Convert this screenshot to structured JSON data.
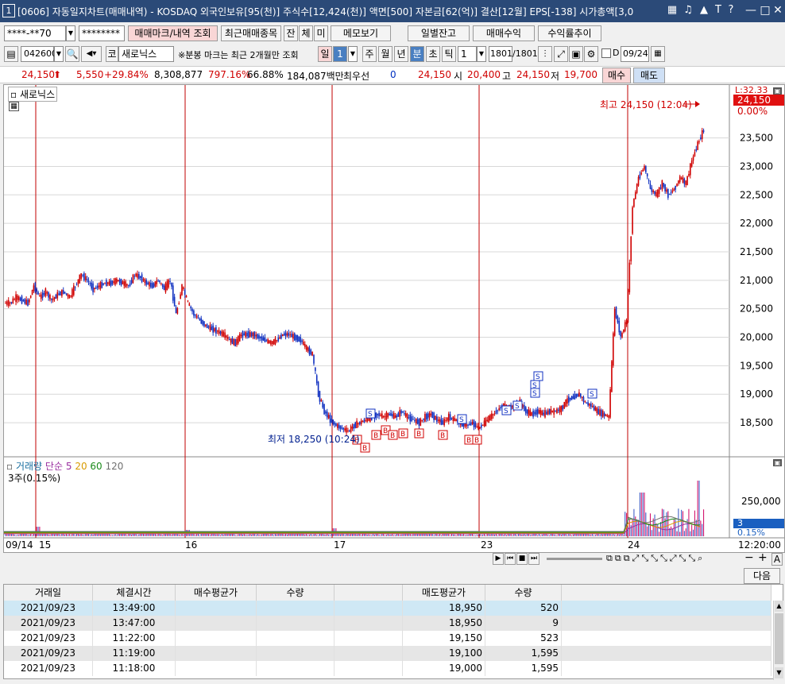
{
  "window": {
    "number": "1",
    "title": "[0606] 자동일지차트(매매내역) - KOSDAQ 외국인보유[95(천)] 주식수[12,424(천)] 액면[500] 자본금[62(억)] 결산[12월] EPS[-138] 시가총액[3,0",
    "icons": [
      "grid-icon",
      "bell-icon",
      "font-icon",
      "help-icon"
    ],
    "controls": [
      "minimize",
      "restore",
      "close"
    ]
  },
  "toolbar1": {
    "account": "****-**70",
    "password": "********",
    "btn_trade_mark": "매매마크/내역 조회",
    "btn_recent": "최근매매종목",
    "btn_jan": "잔",
    "btn_che": "체",
    "btn_mi": "미",
    "btn_memo": "메모보기",
    "btn_daily": "일별잔고",
    "btn_profit": "매매수익",
    "btn_return": "수익률추이"
  },
  "toolbar2": {
    "code": "042600",
    "market": "코",
    "name": "새로닉스",
    "notice": "※분봉 마크는 최근 2개월만 조회",
    "period_day": "일",
    "period_value": "1",
    "period_week": "주",
    "period_month": "월",
    "period_year": "년",
    "period_minute": "분",
    "period_second": "초",
    "period_tick": "틱",
    "interval": "1",
    "count": "1801",
    "total": "/1801",
    "d_label": "D",
    "date": "09/24"
  },
  "quote": {
    "price": "24,150",
    "change": "5,550",
    "change_pct": "+29.84%",
    "volume": "8,308,877",
    "volume_pct": "797.16%",
    "ratio": "66.88%",
    "amount": "184,087백만",
    "best_label": "최우선",
    "best_value": "0",
    "ask": "24,150",
    "open_label": "시",
    "open": "20,400",
    "high_label": "고",
    "high": "24,150",
    "low_label": "저",
    "low": "19,700",
    "buy": "매수",
    "sell": "매도"
  },
  "chart_data": {
    "type": "candlestick",
    "title": "새로닉스",
    "annotations": {
      "high": "최고 24,150 (12:04)",
      "low": "최저 18,250 (10:24)",
      "current_price": "24,150",
      "current_pct": "0.00%",
      "corner": "L:32.33"
    },
    "y_ticks": [
      "23,500",
      "23,000",
      "22,500",
      "22,000",
      "21,500",
      "21,000",
      "20,500",
      "20,000",
      "19,500",
      "19,000",
      "18,500"
    ],
    "x_ticks": [
      "09/14",
      "15",
      "16",
      "17",
      "23",
      "24",
      "12:20:00"
    ],
    "volume_panel": {
      "legend": [
        "거래량",
        "단순",
        "5",
        "20",
        "60",
        "120"
      ],
      "legend_colors": [
        "#1a6fa0",
        "#9a2fa0",
        "#9a2fa0",
        "#d89a00",
        "#1a8a1a",
        "#707070"
      ],
      "sublabel": "3주(0.15%)",
      "y_tick": "250,000",
      "current": "3",
      "current_pct": "0.15%"
    },
    "marks_buy": [
      "B",
      "B",
      "B",
      "B",
      "B",
      "B",
      "B",
      "B",
      "B",
      "B"
    ],
    "marks_sell": [
      "S",
      "S",
      "S",
      "S",
      "S",
      "S",
      "S",
      "S",
      "S"
    ],
    "price_series": [
      20600,
      20700,
      20650,
      20600,
      20900,
      20700,
      20800,
      20650,
      20750,
      20800,
      20700,
      20900,
      21100,
      21000,
      20850,
      20900,
      20950,
      20950,
      21000,
      20950,
      20900,
      21100,
      21050,
      20950,
      20900,
      21000,
      20850,
      21000,
      20400,
      20900,
      20600,
      20400,
      20300,
      20200,
      20150,
      20100,
      20050,
      19950,
      19900,
      20050,
      20050,
      20050,
      20000,
      19950,
      19900,
      19950,
      20050,
      20050,
      20000,
      19950,
      19800,
      19700,
      19000,
      18700,
      18550,
      18450,
      18400,
      18350,
      18450,
      18500,
      18550,
      18600,
      18650,
      18600,
      18650,
      18600,
      18700,
      18600,
      18550,
      18500,
      18600,
      18650,
      18550,
      18500,
      18600,
      18550,
      18500,
      18450,
      18500,
      18400,
      18500,
      18600,
      18700,
      18800,
      18750,
      18800,
      18850,
      18700,
      18650,
      18700,
      18650,
      18700,
      18700,
      18750,
      18900,
      18950,
      19000,
      18850,
      18800,
      18700,
      18650,
      18600,
      20500,
      20000,
      20300,
      22300,
      22800,
      23000,
      22600,
      22500,
      22700,
      22500,
      22600,
      22800,
      22700,
      23100,
      23400,
      23650
    ]
  },
  "toolbar_bottom": {
    "next": "다음"
  },
  "table": {
    "headers": [
      "거래일",
      "체결시간",
      "매수평균가",
      "수량",
      "",
      "매도평균가",
      "수량"
    ],
    "rows": [
      [
        "2021/09/23",
        "13:49:00",
        "",
        "",
        "",
        "18,950",
        "520"
      ],
      [
        "2021/09/23",
        "13:47:00",
        "",
        "",
        "",
        "18,950",
        "9"
      ],
      [
        "2021/09/23",
        "11:22:00",
        "",
        "",
        "",
        "19,150",
        "523"
      ],
      [
        "2021/09/23",
        "11:19:00",
        "",
        "",
        "",
        "19,100",
        "1,595"
      ],
      [
        "2021/09/23",
        "11:18:00",
        "",
        "",
        "",
        "19,000",
        "1,595"
      ]
    ]
  }
}
